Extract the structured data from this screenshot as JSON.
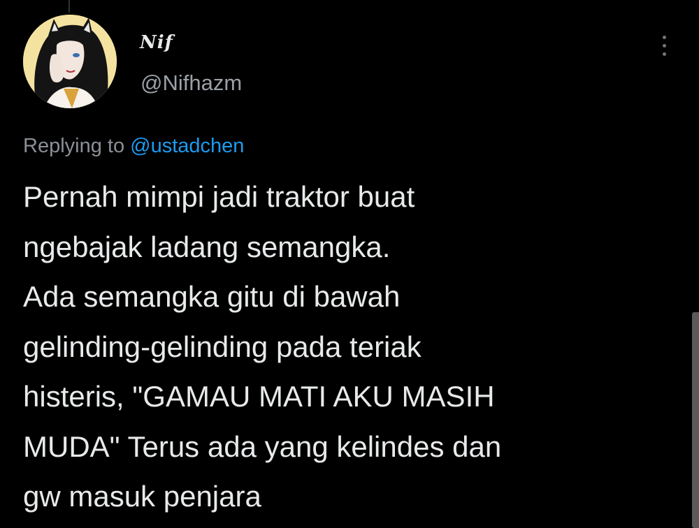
{
  "author": {
    "display_name": "Nif",
    "handle": "@Nifhazm"
  },
  "reply": {
    "prefix": "Replying to ",
    "mention": "@ustadchen"
  },
  "tweet": {
    "lines": [
      "Pernah mimpi jadi traktor buat",
      "ngebajak ladang semangka.",
      "Ada semangka gitu di bawah",
      "gelinding-gelinding pada teriak",
      "histeris, \"GAMAU MATI AKU MASIH",
      "MUDA\" Terus ada yang kelindes dan",
      "gw masuk penjara"
    ]
  },
  "icons": {
    "more": "more-vertical-icon",
    "avatar": "avatar-image"
  },
  "colors": {
    "background": "#000000",
    "text": "#e7e9ea",
    "secondary": "#9aa0a6",
    "link": "#1d9bf0"
  }
}
